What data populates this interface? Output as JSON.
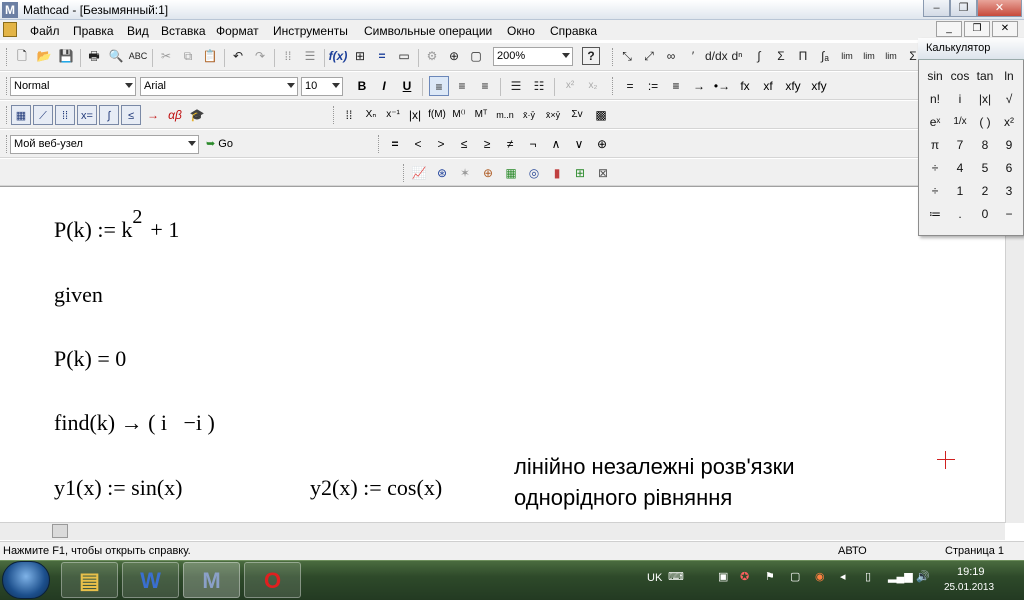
{
  "window": {
    "title": "Mathcad - [Безымянный:1]",
    "logo": "M"
  },
  "menu": [
    "Файл",
    "Правка",
    "Вид",
    "Вставка",
    "Формат",
    "Инструменты",
    "Символьные операции",
    "Окно",
    "Справка"
  ],
  "standard_toolbar": {
    "zoom": "200%",
    "help_icon": "question-icon"
  },
  "format_toolbar": {
    "style": "Normal",
    "font": "Arial",
    "size": "10",
    "bold": "B",
    "italic": "I",
    "underline": "U"
  },
  "web_toolbar": {
    "site": "Мой веб-узел",
    "go": "Go"
  },
  "calc_toolbar_tabs": [
    "=",
    ":=",
    "≡",
    "→",
    "•→",
    "fx",
    "xf",
    "xfy",
    "xfy"
  ],
  "boolean_toolbar": [
    "=",
    "<",
    ">",
    "≤",
    "≥",
    "≠",
    "¬",
    "∧",
    "∨",
    "⊕"
  ],
  "calculator": {
    "title": "Калькулятор",
    "keys": [
      "sin",
      "cos",
      "tan",
      "ln",
      "n!",
      "i",
      "|x|",
      "√",
      "eˣ",
      "1/x",
      "( )",
      "x²",
      "π",
      "7",
      "8",
      "9",
      "÷",
      "4",
      "5",
      "6",
      "÷",
      "1",
      "2",
      "3",
      "≔",
      ".",
      "0",
      "−"
    ]
  },
  "worksheet": {
    "line1": "P(k) := k",
    "line1_exp": "2",
    "line1_tail": "+ 1",
    "line2": "given",
    "line3": "P(k) = 0",
    "line4": "find(k) → ( i   −i )",
    "line5a": "y1(x) := sin(x)",
    "line5b": "y2(x) := cos(x)",
    "note1": "лінійно незалежні розв'язки",
    "note2": "однорідного рівняння"
  },
  "status": {
    "hint": "Нажмите F1, чтобы открыть справку.",
    "mode": "АВТО",
    "page": "Страница 1"
  },
  "taskbar": {
    "lang": "UK",
    "time": "19:19",
    "date": "25.01.2013"
  }
}
